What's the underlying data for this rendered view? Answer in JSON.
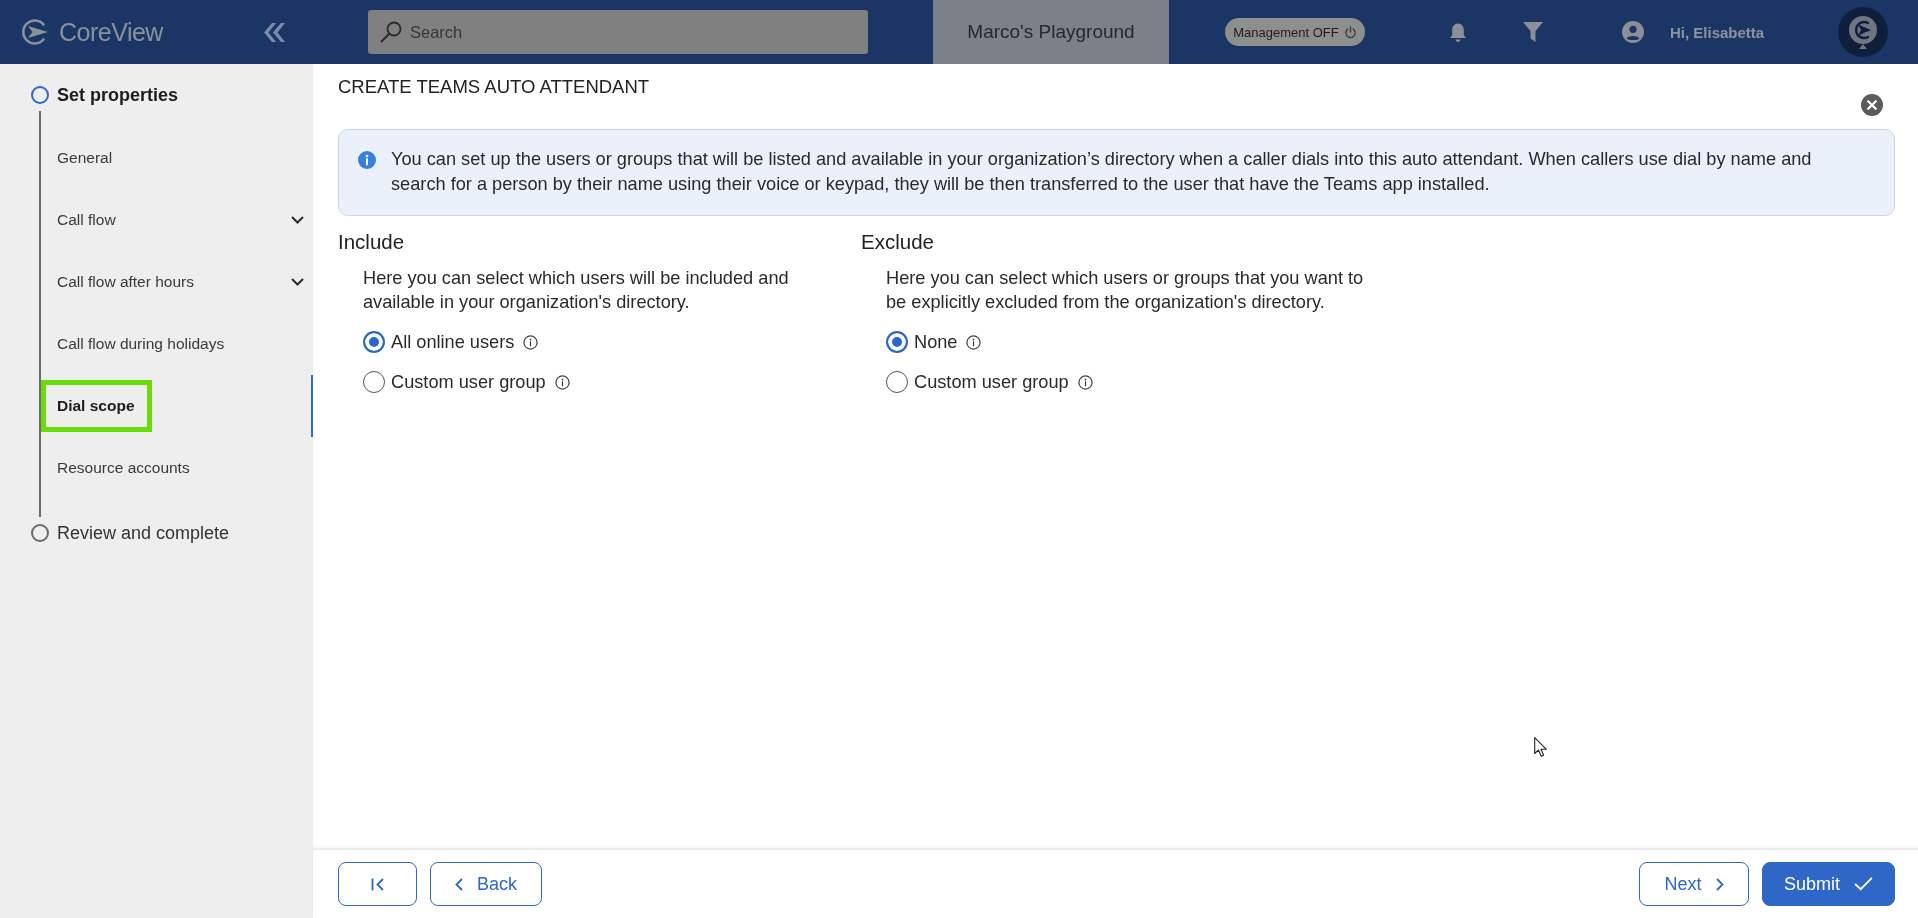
{
  "header": {
    "logo_text": "CoreView",
    "search": {
      "placeholder": "Search"
    },
    "workspace": "Marco's Playground",
    "management": {
      "label": "Management OFF",
      "on": false
    },
    "greeting": "Hi, Elisabetta"
  },
  "sidebar": {
    "steps": [
      {
        "label": "Set properties",
        "active": true,
        "children": [
          {
            "label": "General",
            "selected": false,
            "expandable": false
          },
          {
            "label": "Call flow",
            "selected": false,
            "expandable": true
          },
          {
            "label": "Call flow after hours",
            "selected": false,
            "expandable": true
          },
          {
            "label": "Call flow during holidays",
            "selected": false,
            "expandable": false
          },
          {
            "label": "Dial scope",
            "selected": true,
            "expandable": false
          },
          {
            "label": "Resource accounts",
            "selected": false,
            "expandable": false
          }
        ]
      },
      {
        "label": "Review and complete",
        "active": false
      }
    ]
  },
  "page": {
    "title": "CREATE TEAMS AUTO ATTENDANT",
    "info": "You can set up the users or groups that will be listed and available in your organization’s directory when a caller dials into this auto attendant. When callers use dial by name and search for a person by their name using their voice or keypad, they will be then transferred to the user that have the Teams app installed.",
    "sections": [
      {
        "heading": "Include",
        "description": "Here you can select which users will be included and available in your organization's directory.",
        "options": [
          {
            "label": "All online users",
            "selected": true
          },
          {
            "label": "Custom user group",
            "selected": false
          }
        ]
      },
      {
        "heading": "Exclude",
        "description": "Here you can select which users or groups that you want to be explicitly excluded from the organization's directory.",
        "options": [
          {
            "label": "None",
            "selected": true
          },
          {
            "label": "Custom user group",
            "selected": false
          }
        ]
      }
    ]
  },
  "footer": {
    "buttons": [
      {
        "kind": "first"
      },
      {
        "kind": "back",
        "label": "Back"
      },
      {
        "kind": "next",
        "label": "Next"
      },
      {
        "kind": "submit",
        "label": "Submit"
      }
    ]
  }
}
